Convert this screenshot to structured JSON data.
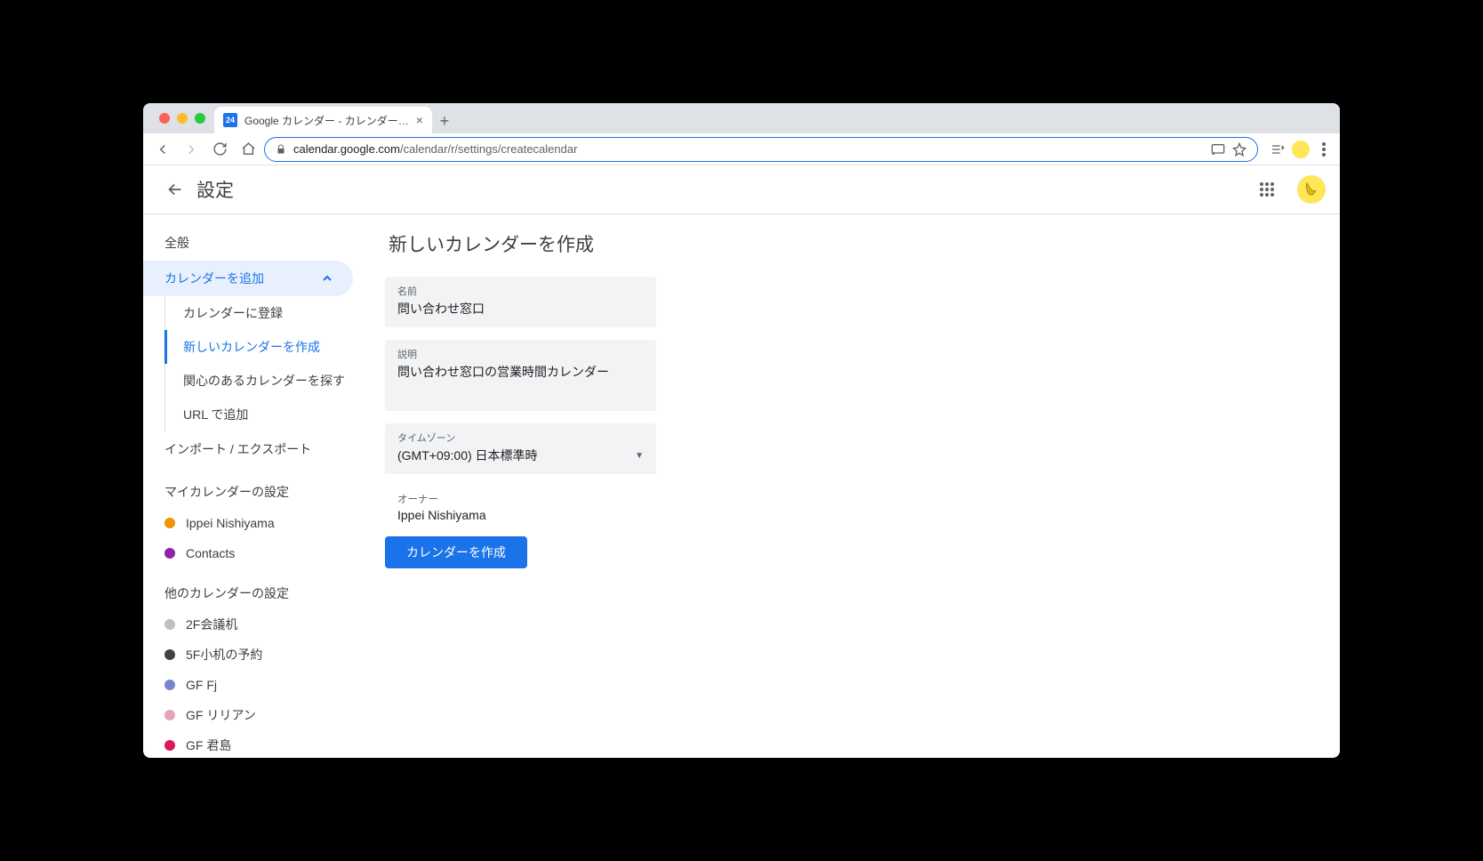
{
  "browser": {
    "tab_favicon_text": "24",
    "tab_title": "Google カレンダー - カレンダー…",
    "url_host": "calendar.google.com",
    "url_path": "/calendar/r/settings/createcalendar"
  },
  "header": {
    "title": "設定"
  },
  "sidebar": {
    "general": "全般",
    "add_calendar": "カレンダーを追加",
    "sub": {
      "subscribe": "カレンダーに登録",
      "create": "新しいカレンダーを作成",
      "browse": "関心のあるカレンダーを探す",
      "url": "URL で追加"
    },
    "import_export": "インポート / エクスポート",
    "my_cal_header": "マイカレンダーの設定",
    "my_cals": [
      {
        "label": "Ippei Nishiyama",
        "color": "#f09300"
      },
      {
        "label": "Contacts",
        "color": "#8e24aa"
      }
    ],
    "other_cal_header": "他のカレンダーの設定",
    "other_cals": [
      {
        "label": "2F会議机",
        "color": "#c0c0c0"
      },
      {
        "label": "5F小机の予約",
        "color": "#424242"
      },
      {
        "label": "GF Fj",
        "color": "#7986cb"
      },
      {
        "label": "GF リリアン",
        "color": "#e8a3b6"
      },
      {
        "label": "GF 君島",
        "color": "#d81b60"
      }
    ]
  },
  "main": {
    "heading": "新しいカレンダーを作成",
    "name_label": "名前",
    "name_value": "問い合わせ窓口",
    "desc_label": "説明",
    "desc_value": "問い合わせ窓口の営業時間カレンダー",
    "tz_label": "タイムゾーン",
    "tz_value": "(GMT+09:00) 日本標準時",
    "owner_label": "オーナー",
    "owner_value": "Ippei Nishiyama",
    "create_button": "カレンダーを作成"
  }
}
